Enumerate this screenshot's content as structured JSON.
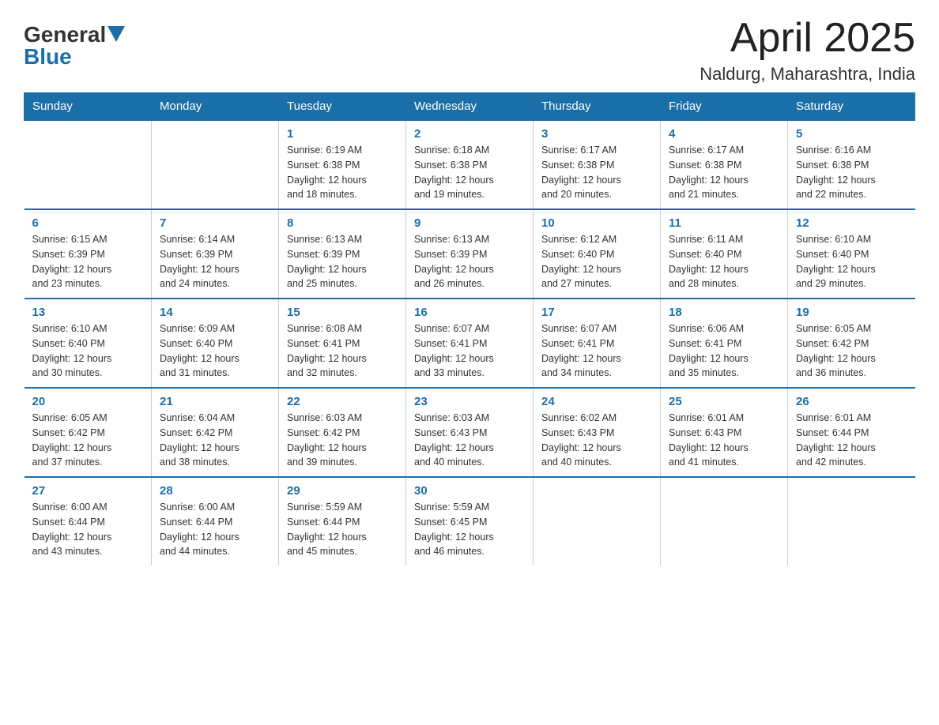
{
  "header": {
    "logo_general": "General",
    "logo_blue": "Blue",
    "title": "April 2025",
    "subtitle": "Naldurg, Maharashtra, India"
  },
  "days_of_week": [
    "Sunday",
    "Monday",
    "Tuesday",
    "Wednesday",
    "Thursday",
    "Friday",
    "Saturday"
  ],
  "weeks": [
    [
      {
        "day": "",
        "info": ""
      },
      {
        "day": "",
        "info": ""
      },
      {
        "day": "1",
        "info": "Sunrise: 6:19 AM\nSunset: 6:38 PM\nDaylight: 12 hours\nand 18 minutes."
      },
      {
        "day": "2",
        "info": "Sunrise: 6:18 AM\nSunset: 6:38 PM\nDaylight: 12 hours\nand 19 minutes."
      },
      {
        "day": "3",
        "info": "Sunrise: 6:17 AM\nSunset: 6:38 PM\nDaylight: 12 hours\nand 20 minutes."
      },
      {
        "day": "4",
        "info": "Sunrise: 6:17 AM\nSunset: 6:38 PM\nDaylight: 12 hours\nand 21 minutes."
      },
      {
        "day": "5",
        "info": "Sunrise: 6:16 AM\nSunset: 6:38 PM\nDaylight: 12 hours\nand 22 minutes."
      }
    ],
    [
      {
        "day": "6",
        "info": "Sunrise: 6:15 AM\nSunset: 6:39 PM\nDaylight: 12 hours\nand 23 minutes."
      },
      {
        "day": "7",
        "info": "Sunrise: 6:14 AM\nSunset: 6:39 PM\nDaylight: 12 hours\nand 24 minutes."
      },
      {
        "day": "8",
        "info": "Sunrise: 6:13 AM\nSunset: 6:39 PM\nDaylight: 12 hours\nand 25 minutes."
      },
      {
        "day": "9",
        "info": "Sunrise: 6:13 AM\nSunset: 6:39 PM\nDaylight: 12 hours\nand 26 minutes."
      },
      {
        "day": "10",
        "info": "Sunrise: 6:12 AM\nSunset: 6:40 PM\nDaylight: 12 hours\nand 27 minutes."
      },
      {
        "day": "11",
        "info": "Sunrise: 6:11 AM\nSunset: 6:40 PM\nDaylight: 12 hours\nand 28 minutes."
      },
      {
        "day": "12",
        "info": "Sunrise: 6:10 AM\nSunset: 6:40 PM\nDaylight: 12 hours\nand 29 minutes."
      }
    ],
    [
      {
        "day": "13",
        "info": "Sunrise: 6:10 AM\nSunset: 6:40 PM\nDaylight: 12 hours\nand 30 minutes."
      },
      {
        "day": "14",
        "info": "Sunrise: 6:09 AM\nSunset: 6:40 PM\nDaylight: 12 hours\nand 31 minutes."
      },
      {
        "day": "15",
        "info": "Sunrise: 6:08 AM\nSunset: 6:41 PM\nDaylight: 12 hours\nand 32 minutes."
      },
      {
        "day": "16",
        "info": "Sunrise: 6:07 AM\nSunset: 6:41 PM\nDaylight: 12 hours\nand 33 minutes."
      },
      {
        "day": "17",
        "info": "Sunrise: 6:07 AM\nSunset: 6:41 PM\nDaylight: 12 hours\nand 34 minutes."
      },
      {
        "day": "18",
        "info": "Sunrise: 6:06 AM\nSunset: 6:41 PM\nDaylight: 12 hours\nand 35 minutes."
      },
      {
        "day": "19",
        "info": "Sunrise: 6:05 AM\nSunset: 6:42 PM\nDaylight: 12 hours\nand 36 minutes."
      }
    ],
    [
      {
        "day": "20",
        "info": "Sunrise: 6:05 AM\nSunset: 6:42 PM\nDaylight: 12 hours\nand 37 minutes."
      },
      {
        "day": "21",
        "info": "Sunrise: 6:04 AM\nSunset: 6:42 PM\nDaylight: 12 hours\nand 38 minutes."
      },
      {
        "day": "22",
        "info": "Sunrise: 6:03 AM\nSunset: 6:42 PM\nDaylight: 12 hours\nand 39 minutes."
      },
      {
        "day": "23",
        "info": "Sunrise: 6:03 AM\nSunset: 6:43 PM\nDaylight: 12 hours\nand 40 minutes."
      },
      {
        "day": "24",
        "info": "Sunrise: 6:02 AM\nSunset: 6:43 PM\nDaylight: 12 hours\nand 40 minutes."
      },
      {
        "day": "25",
        "info": "Sunrise: 6:01 AM\nSunset: 6:43 PM\nDaylight: 12 hours\nand 41 minutes."
      },
      {
        "day": "26",
        "info": "Sunrise: 6:01 AM\nSunset: 6:44 PM\nDaylight: 12 hours\nand 42 minutes."
      }
    ],
    [
      {
        "day": "27",
        "info": "Sunrise: 6:00 AM\nSunset: 6:44 PM\nDaylight: 12 hours\nand 43 minutes."
      },
      {
        "day": "28",
        "info": "Sunrise: 6:00 AM\nSunset: 6:44 PM\nDaylight: 12 hours\nand 44 minutes."
      },
      {
        "day": "29",
        "info": "Sunrise: 5:59 AM\nSunset: 6:44 PM\nDaylight: 12 hours\nand 45 minutes."
      },
      {
        "day": "30",
        "info": "Sunrise: 5:59 AM\nSunset: 6:45 PM\nDaylight: 12 hours\nand 46 minutes."
      },
      {
        "day": "",
        "info": ""
      },
      {
        "day": "",
        "info": ""
      },
      {
        "day": "",
        "info": ""
      }
    ]
  ]
}
